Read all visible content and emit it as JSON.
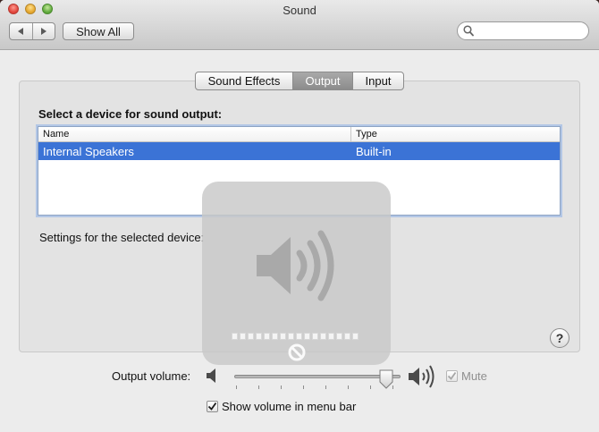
{
  "window": {
    "title": "Sound"
  },
  "toolbar": {
    "show_all_label": "Show All",
    "search_placeholder": ""
  },
  "tabs": [
    {
      "label": "Sound Effects",
      "active": false
    },
    {
      "label": "Output",
      "active": true
    },
    {
      "label": "Input",
      "active": false
    }
  ],
  "output": {
    "heading": "Select a device for sound output:",
    "columns": [
      "Name",
      "Type"
    ],
    "devices": [
      {
        "name": "Internal Speakers",
        "type": "Built-in",
        "selected": true
      }
    ],
    "settings_label": "Settings for the selected device:"
  },
  "volume": {
    "label": "Output volume:",
    "level": 0.95,
    "mute_label": "Mute",
    "mute_checked": true,
    "mute_enabled": false,
    "show_in_menu_label": "Show volume in menu bar",
    "show_in_menu_checked": true
  },
  "hud": {
    "segments": 16,
    "filled_segments": 0
  },
  "colors": {
    "selection": "#3b73d6",
    "accent_tab": "#9b9b9b",
    "desktop": "#3a2420"
  },
  "icons": [
    "close-icon",
    "minimize-icon",
    "zoom-icon",
    "back-icon",
    "forward-icon",
    "search-icon",
    "speaker-low-icon",
    "speaker-high-icon",
    "help-icon",
    "no-sign-icon"
  ]
}
